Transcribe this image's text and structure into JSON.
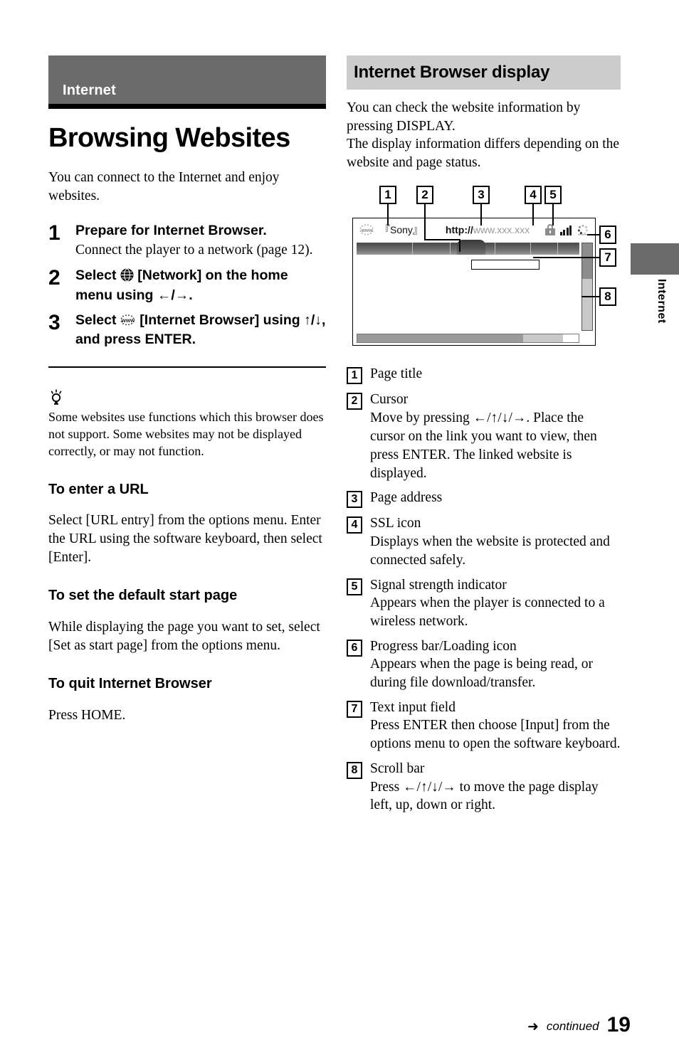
{
  "section": {
    "banner_label": "Internet",
    "chapter_title": "Browsing Websites",
    "intro": "You can connect to the Internet and enjoy websites."
  },
  "steps": [
    {
      "number": "1",
      "heading": "Prepare for Internet Browser.",
      "detail": "Connect the player to a network (page 12)."
    },
    {
      "number": "2",
      "heading_pre": "Select",
      "icon": "globe-network-icon",
      "heading_post": "[Network] on the home menu using ←/→.",
      "detail": ""
    },
    {
      "number": "3",
      "heading_pre": "Select",
      "icon": "www-browser-icon",
      "heading_post": "[Internet Browser] using ↑/↓, and press ENTER.",
      "detail": ""
    }
  ],
  "tip": {
    "icon": "lightbulb-tip-icon",
    "text": "Some websites use functions which this browser does not support. Some websites may not be displayed correctly, or may not function."
  },
  "subsections": [
    {
      "heading": "To enter a URL",
      "text": "Select [URL entry] from the options menu. Enter the URL using the software keyboard, then select [Enter]."
    },
    {
      "heading": "To set the default start page",
      "text": "While displaying the page you want to set, select [Set as start page] from the options menu."
    },
    {
      "heading": "To quit Internet Browser",
      "text": "Press HOME."
    }
  ],
  "right": {
    "heading": "Internet Browser display",
    "intro": "You can check the website information by pressing DISPLAY.\nThe display information differs depending on the website and page status."
  },
  "figure": {
    "callouts": [
      "1",
      "2",
      "3",
      "4",
      "5",
      "6",
      "7",
      "8"
    ],
    "device": {
      "www_icon": "www-globe-icon",
      "page_title": "『Sony』",
      "address_protocol": "http://",
      "address_host": "www.xxx.xxx",
      "ssl_icon": "lock-icon",
      "signal_icon": "signal-bars-icon",
      "loading_icon": "loading-spinner-icon"
    }
  },
  "legend": [
    {
      "num": "1",
      "title": "Page title",
      "desc": ""
    },
    {
      "num": "2",
      "title": "Cursor",
      "desc": "Move by pressing ←/↑/↓/→. Place the cursor on the link you want to view, then press ENTER. The linked website is displayed."
    },
    {
      "num": "3",
      "title": "Page address",
      "desc": ""
    },
    {
      "num": "4",
      "title": "SSL icon",
      "desc": "Displays when the website is protected and connected safely."
    },
    {
      "num": "5",
      "title": "Signal strength indicator",
      "desc": "Appears when the player is connected to a wireless network."
    },
    {
      "num": "6",
      "title": "Progress bar/Loading icon",
      "desc": "Appears when the page is being read, or during file download/transfer."
    },
    {
      "num": "7",
      "title": "Text input field",
      "desc": "Press ENTER then choose [Input] from the options menu to open the software keyboard."
    },
    {
      "num": "8",
      "title": "Scroll bar",
      "desc": "Press ←/↑/↓/→ to move the page display left, up, down or right."
    }
  ],
  "side_tab": {
    "label": "Internet"
  },
  "footer": {
    "arrow": "➜",
    "continued": "continued",
    "page_number": "19"
  },
  "colors": {
    "banner_gray": "#6b6b6b",
    "heading_gray": "#cccccc",
    "rule_black": "#000000"
  }
}
